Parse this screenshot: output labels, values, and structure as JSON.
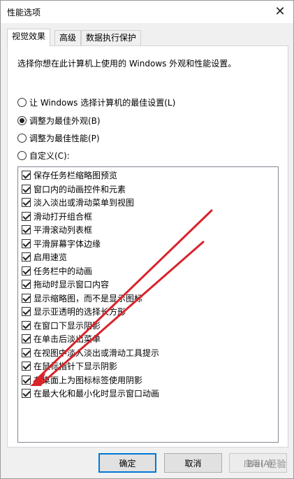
{
  "window": {
    "title": "性能选项",
    "close_glyph": "✕"
  },
  "tabs": [
    {
      "label": "视觉效果",
      "active": true
    },
    {
      "label": "高级",
      "active": false
    },
    {
      "label": "数据执行保护",
      "active": false
    }
  ],
  "description": "选择你想在此计算机上使用的 Windows 外观和性能设置。",
  "radios": [
    {
      "label": "让 Windows 选择计算机的最佳设置(L)",
      "checked": false
    },
    {
      "label": "调整为最佳外观(B)",
      "checked": true
    },
    {
      "label": "调整为最佳性能(P)",
      "checked": false
    },
    {
      "label": "自定义(C):",
      "checked": false
    }
  ],
  "options": [
    {
      "label": "保存任务栏缩略图预览",
      "checked": true
    },
    {
      "label": "窗口内的动画控件和元素",
      "checked": true
    },
    {
      "label": "淡入淡出或滑动菜单到视图",
      "checked": true
    },
    {
      "label": "滑动打开组合框",
      "checked": true
    },
    {
      "label": "平滑滚动列表框",
      "checked": true
    },
    {
      "label": "平滑屏幕字体边缘",
      "checked": true
    },
    {
      "label": "启用速览",
      "checked": true
    },
    {
      "label": "任务栏中的动画",
      "checked": true
    },
    {
      "label": "拖动时显示窗口内容",
      "checked": true
    },
    {
      "label": "显示缩略图，而不是显示图标",
      "checked": true
    },
    {
      "label": "显示亚透明的选择长方形",
      "checked": true
    },
    {
      "label": "在窗口下显示阴影",
      "checked": true
    },
    {
      "label": "在单击后淡出菜单",
      "checked": true
    },
    {
      "label": "在视图中淡入淡出或滑动工具提示",
      "checked": true
    },
    {
      "label": "在鼠标指针下显示阴影",
      "checked": true
    },
    {
      "label": "在桌面上为图标标签使用阴影",
      "checked": true
    },
    {
      "label": "在最大化和最小化时显示窗口动画",
      "checked": true
    }
  ],
  "buttons": {
    "ok": "确定",
    "cancel": "取消",
    "apply": "应用(A)"
  },
  "colors": {
    "annotation_arrow": "#d9232b",
    "default_button_border": "#0078d7"
  },
  "watermark": "Bai 经验"
}
